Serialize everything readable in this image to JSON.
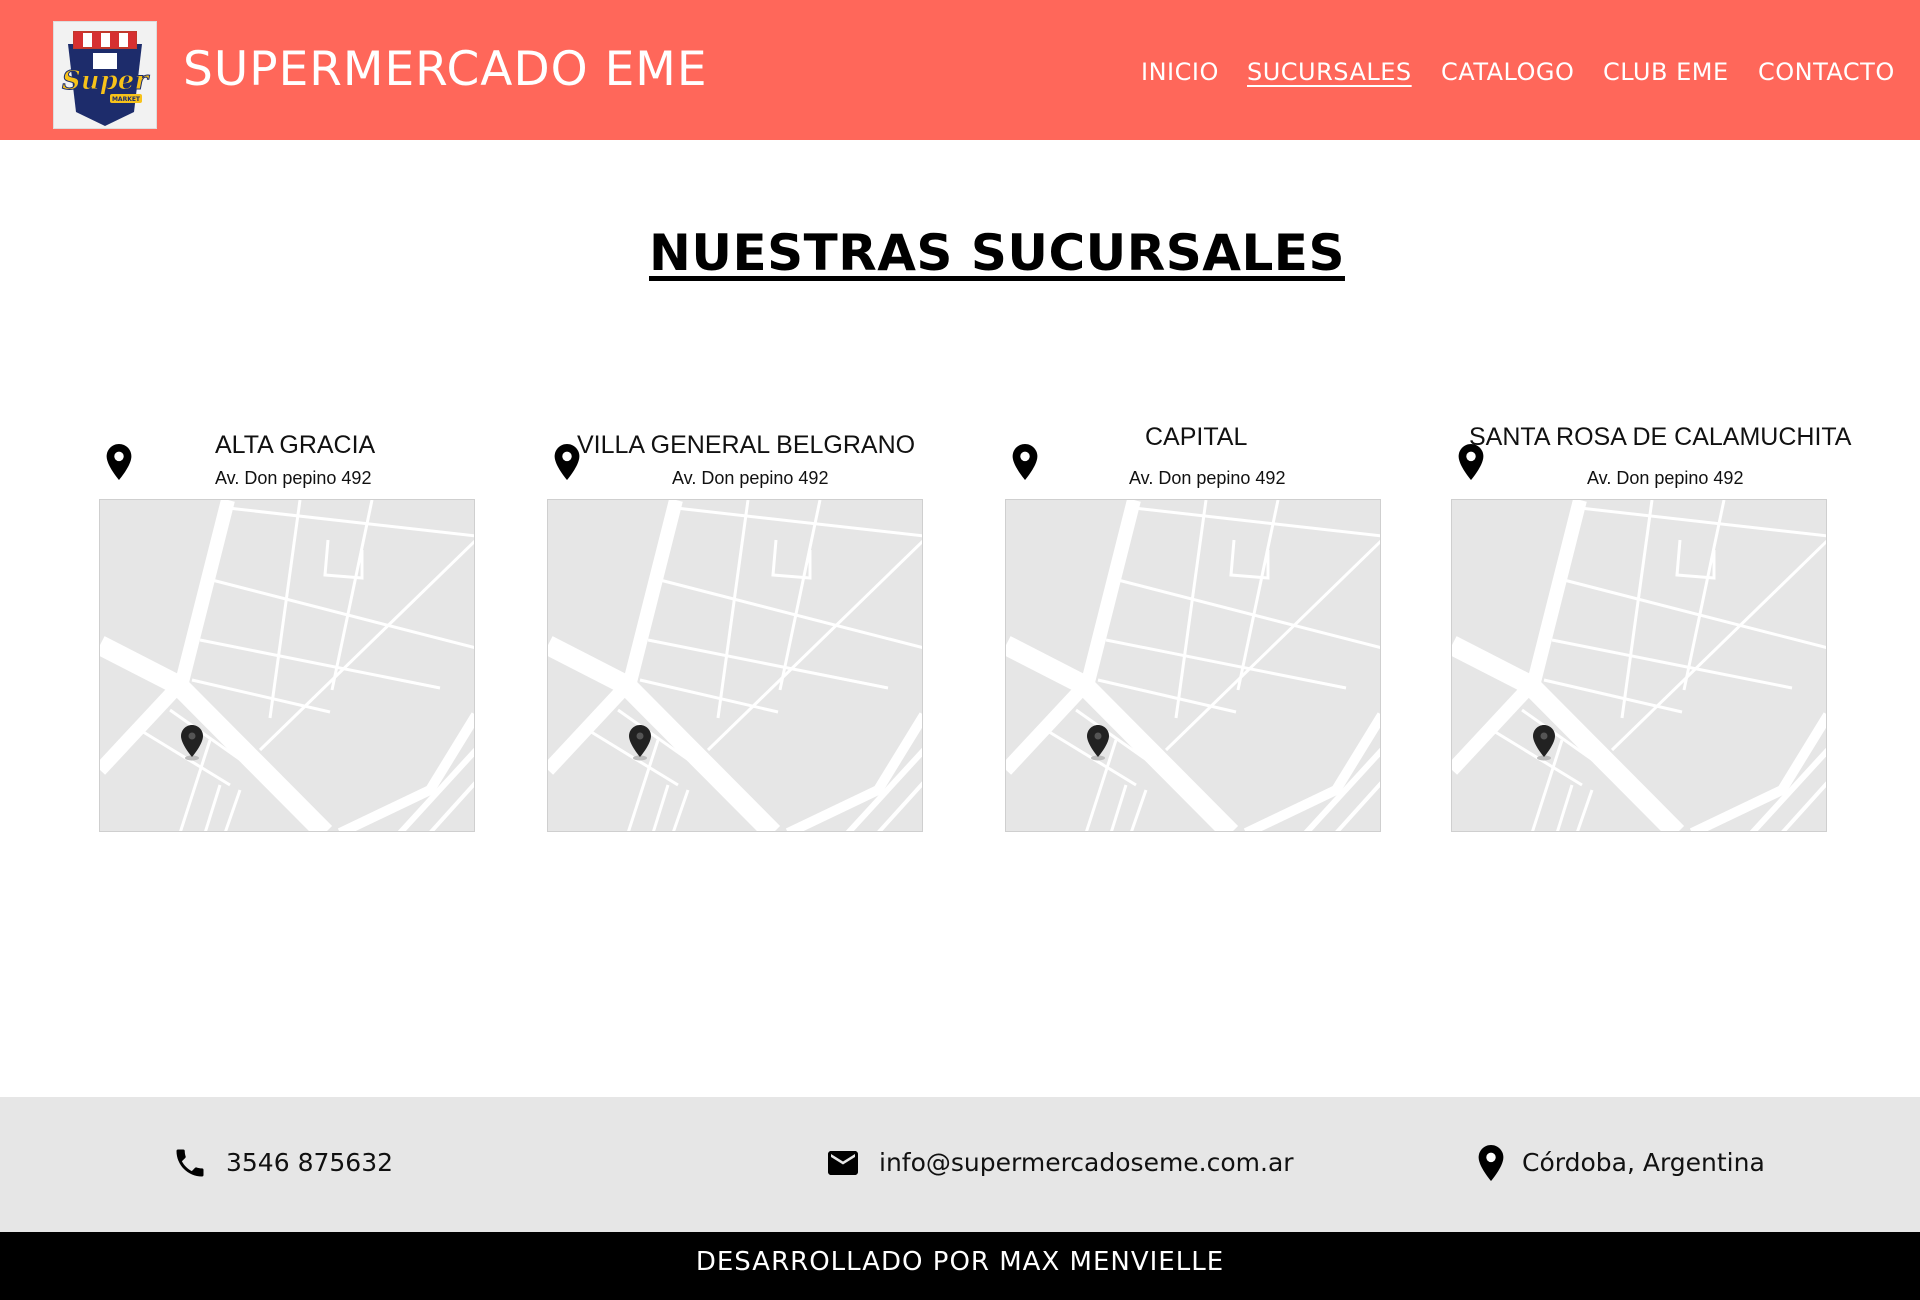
{
  "header": {
    "logo_text": "Super",
    "logo_subtext": "MARKET",
    "brand": "SUPERMERCADO EME",
    "nav": [
      "INICIO",
      "SUCURSALES",
      "CATALOGO",
      "CLUB EME",
      "CONTACTO"
    ],
    "active_nav": "SUCURSALES",
    "color": "#ff675a"
  },
  "main": {
    "title": "NUESTRAS SUCURSALES",
    "branches": [
      {
        "name": "ALTA GRACIA",
        "address": "Av. Don pepino 492"
      },
      {
        "name": "VILLA GENERAL BELGRANO",
        "address": "Av. Don pepino 492"
      },
      {
        "name": "CAPITAL",
        "address": "Av. Don pepino 492"
      },
      {
        "name": "SANTA ROSA DE CALAMUCHITA",
        "address": "Av. Don pepino 492"
      }
    ]
  },
  "footer": {
    "phone": "3546 875632",
    "email": "info@supermercadoseme.com.ar",
    "location": "Córdoba, Argentina",
    "credit": "DESARROLLADO POR MAX MENVIELLE",
    "icons": [
      "phone-icon",
      "mail-icon",
      "location-pin-icon"
    ]
  }
}
